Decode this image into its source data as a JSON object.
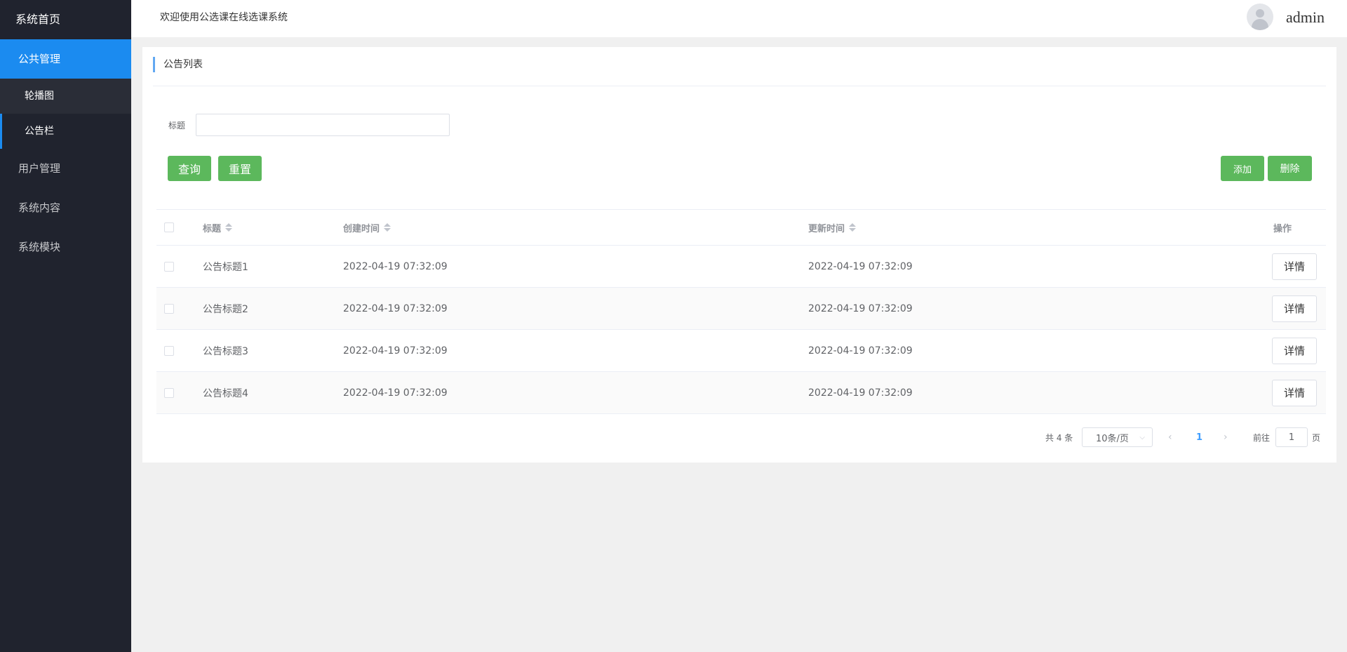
{
  "sidebar": {
    "home": "系统首页",
    "items": [
      {
        "label": "公共管理",
        "active": true
      },
      {
        "label": "用户管理"
      },
      {
        "label": "系统内容"
      },
      {
        "label": "系统模块"
      }
    ],
    "sub_items": [
      {
        "label": "轮播图"
      },
      {
        "label": "公告栏"
      }
    ]
  },
  "header": {
    "welcome": "欢迎使用公选课在线选课系统",
    "username": "admin"
  },
  "panel": {
    "title": "公告列表"
  },
  "search": {
    "label": "标题",
    "value": "",
    "placeholder": ""
  },
  "toolbar": {
    "query_label": "查询",
    "reset_label": "重置",
    "add_label": "添加",
    "delete_label": "删除"
  },
  "table": {
    "columns": [
      "标题",
      "创建时间",
      "更新时间",
      "操作"
    ],
    "rows": [
      {
        "title": "公告标题1",
        "created": "2022-04-19 07:32:09",
        "updated": "2022-04-19 07:32:09",
        "action": "详情"
      },
      {
        "title": "公告标题2",
        "created": "2022-04-19 07:32:09",
        "updated": "2022-04-19 07:32:09",
        "action": "详情"
      },
      {
        "title": "公告标题3",
        "created": "2022-04-19 07:32:09",
        "updated": "2022-04-19 07:32:09",
        "action": "详情"
      },
      {
        "title": "公告标题4",
        "created": "2022-04-19 07:32:09",
        "updated": "2022-04-19 07:32:09",
        "action": "详情"
      }
    ]
  },
  "pagination": {
    "total": "共 4 条",
    "page_size": "10条/页",
    "current_page": "1",
    "goto_label": "前往",
    "goto_value": "1",
    "page_suffix": "页"
  },
  "colors": {
    "sidebar_bg": "#20232e",
    "sidebar_active": "#1b8bf0",
    "button_green": "#5cb85c",
    "page_link": "#409eff"
  }
}
